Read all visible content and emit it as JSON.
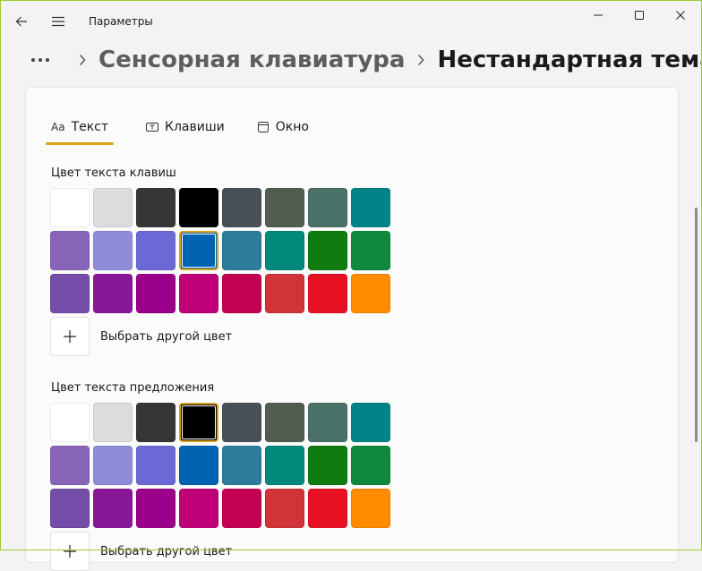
{
  "app": {
    "title": "Параметры"
  },
  "breadcrumb": {
    "parent": "Сенсорная клавиатура",
    "current": "Нестандартная тема"
  },
  "tabs": [
    {
      "label": "Текст",
      "icon_text": "Aa",
      "active": true
    },
    {
      "label": "Клавиши",
      "icon": "keyboard-key-icon",
      "active": false
    },
    {
      "label": "Окно",
      "icon": "window-icon",
      "active": false
    }
  ],
  "sections": [
    {
      "label": "Цвет текста клавиш",
      "selected_index": 11,
      "custom_label": "Выбрать другой цвет"
    },
    {
      "label": "Цвет текста предложения",
      "selected_index": 3,
      "custom_label": "Выбрать другой цвет"
    }
  ],
  "palette": [
    "#ffffff",
    "#dcdcdc",
    "#363636",
    "#000000",
    "#4a5058",
    "#525d52",
    "#4a7168",
    "#038387",
    "#8764b8",
    "#8e8cd8",
    "#6b69d6",
    "#0063b1",
    "#2d7d9a",
    "#00897b",
    "#107c10",
    "#10893e",
    "#744da9",
    "#881798",
    "#9a0089",
    "#bf0077",
    "#c30052",
    "#d13438",
    "#e81123",
    "#ff8c00"
  ],
  "colors": {
    "accent": "#d8a31a",
    "window_border": "#9ccc2c"
  }
}
